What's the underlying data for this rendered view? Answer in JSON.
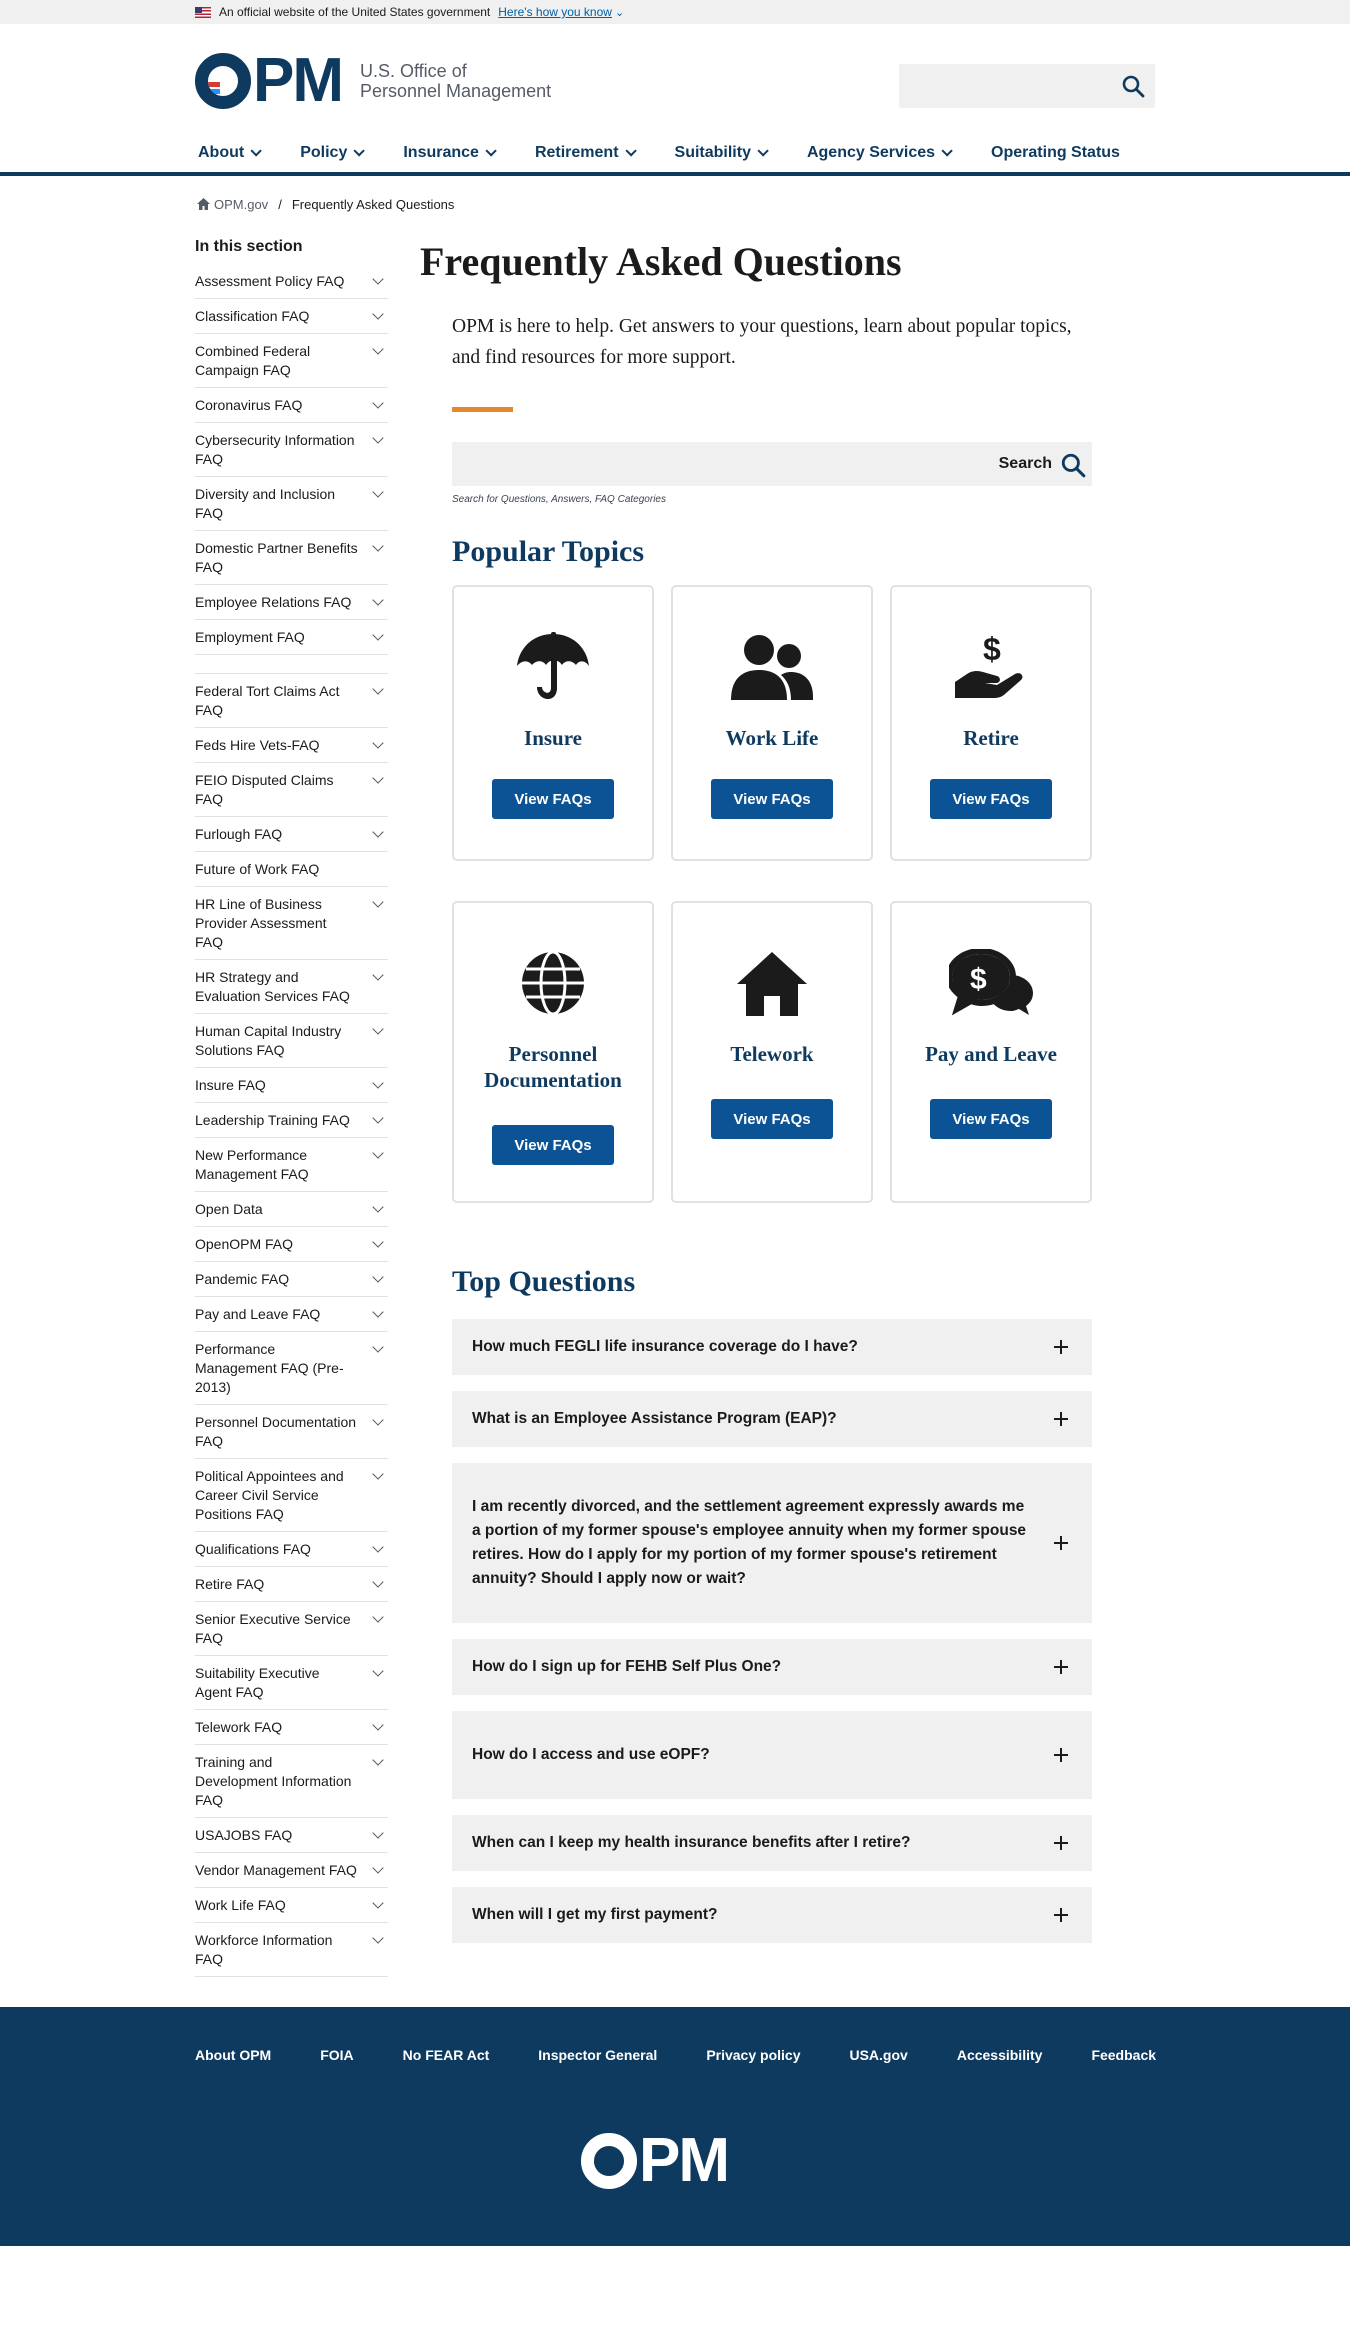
{
  "banner": {
    "text": "An official website of the United States government",
    "link": "Here's how you know"
  },
  "header": {
    "logo_text": "OPM",
    "org_line1": "U.S. Office of",
    "org_line2": "Personnel Management"
  },
  "nav": [
    {
      "label": "About"
    },
    {
      "label": "Policy"
    },
    {
      "label": "Insurance"
    },
    {
      "label": "Retirement"
    },
    {
      "label": "Suitability"
    },
    {
      "label": "Agency Services"
    },
    {
      "label": "Operating Status"
    }
  ],
  "breadcrumb": {
    "home": "OPM.gov",
    "separator": "/",
    "current": "Frequently Asked Questions"
  },
  "sidenav": {
    "heading": "In this section",
    "items": [
      "Assessment Policy FAQ",
      "Classification FAQ",
      "Combined Federal Campaign FAQ",
      "Coronavirus FAQ",
      "Cybersecurity Information FAQ",
      "Diversity and Inclusion FAQ",
      "Domestic Partner Benefits FAQ",
      "Employee Relations FAQ",
      "Employment FAQ",
      "",
      "Federal Tort Claims Act FAQ",
      "Feds Hire Vets-FAQ",
      "FEIO Disputed Claims FAQ",
      "Furlough FAQ",
      "Future of Work FAQ",
      "HR Line of Business Provider Assessment FAQ",
      "HR Strategy and Evaluation Services FAQ",
      "Human Capital Industry Solutions FAQ",
      "Insure FAQ",
      "Leadership Training FAQ",
      "New Performance Management FAQ",
      "Open Data",
      "OpenOPM FAQ",
      "Pandemic FAQ",
      "Pay and Leave FAQ",
      "Performance Management FAQ (Pre-2013)",
      "Personnel Documentation FAQ",
      "Political Appointees and Career Civil Service Positions FAQ",
      "Qualifications FAQ",
      "Retire FAQ",
      "Senior Executive Service FAQ",
      "Suitability Executive Agent FAQ",
      "Telework FAQ",
      "Training and Development Information FAQ",
      "USAJOBS FAQ",
      "Vendor Management FAQ",
      "Work Life FAQ",
      "Workforce Information FAQ"
    ]
  },
  "main": {
    "title": "Frequently Asked Questions",
    "intro": "OPM is here to help. Get answers to your questions, learn about popular topics, and find resources for more support.",
    "search_label": "Search",
    "search_hint": "Search for Questions, Answers, FAQ Categories",
    "popular_heading": "Popular Topics",
    "topics": [
      {
        "title": "Insure",
        "icon": "umbrella-icon",
        "button": "View FAQs"
      },
      {
        "title": "Work Life",
        "icon": "users-icon",
        "button": "View FAQs"
      },
      {
        "title": "Retire",
        "icon": "hand-dollar-icon",
        "button": "View FAQs"
      },
      {
        "title": "Personnel Documentation",
        "icon": "globe-icon",
        "button": "View FAQs"
      },
      {
        "title": "Telework",
        "icon": "home-icon",
        "button": "View FAQs"
      },
      {
        "title": "Pay and Leave",
        "icon": "dollar-chat-icon",
        "button": "View FAQs"
      }
    ],
    "top_heading": "Top Questions",
    "questions": [
      "How much FEGLI life insurance coverage do I have?",
      "What is an Employee Assistance Program (EAP)?",
      "I am recently divorced, and the settlement agreement expressly awards me a portion of my former spouse's employee annuity when my former spouse retires. How do I apply for my portion of my former spouse's retirement annuity? Should I apply now or wait?",
      "How do I sign up for FEHB Self Plus One?",
      "How do I access and use eOPF?",
      "When can I keep my health insurance benefits after I retire?",
      "When will I get my first payment?"
    ]
  },
  "footer": {
    "links": [
      "About OPM",
      "FOIA",
      "No FEAR Act",
      "Inspector General",
      "Privacy policy",
      "USA.gov",
      "Accessibility",
      "Feedback"
    ],
    "logo_text": "OPM"
  }
}
